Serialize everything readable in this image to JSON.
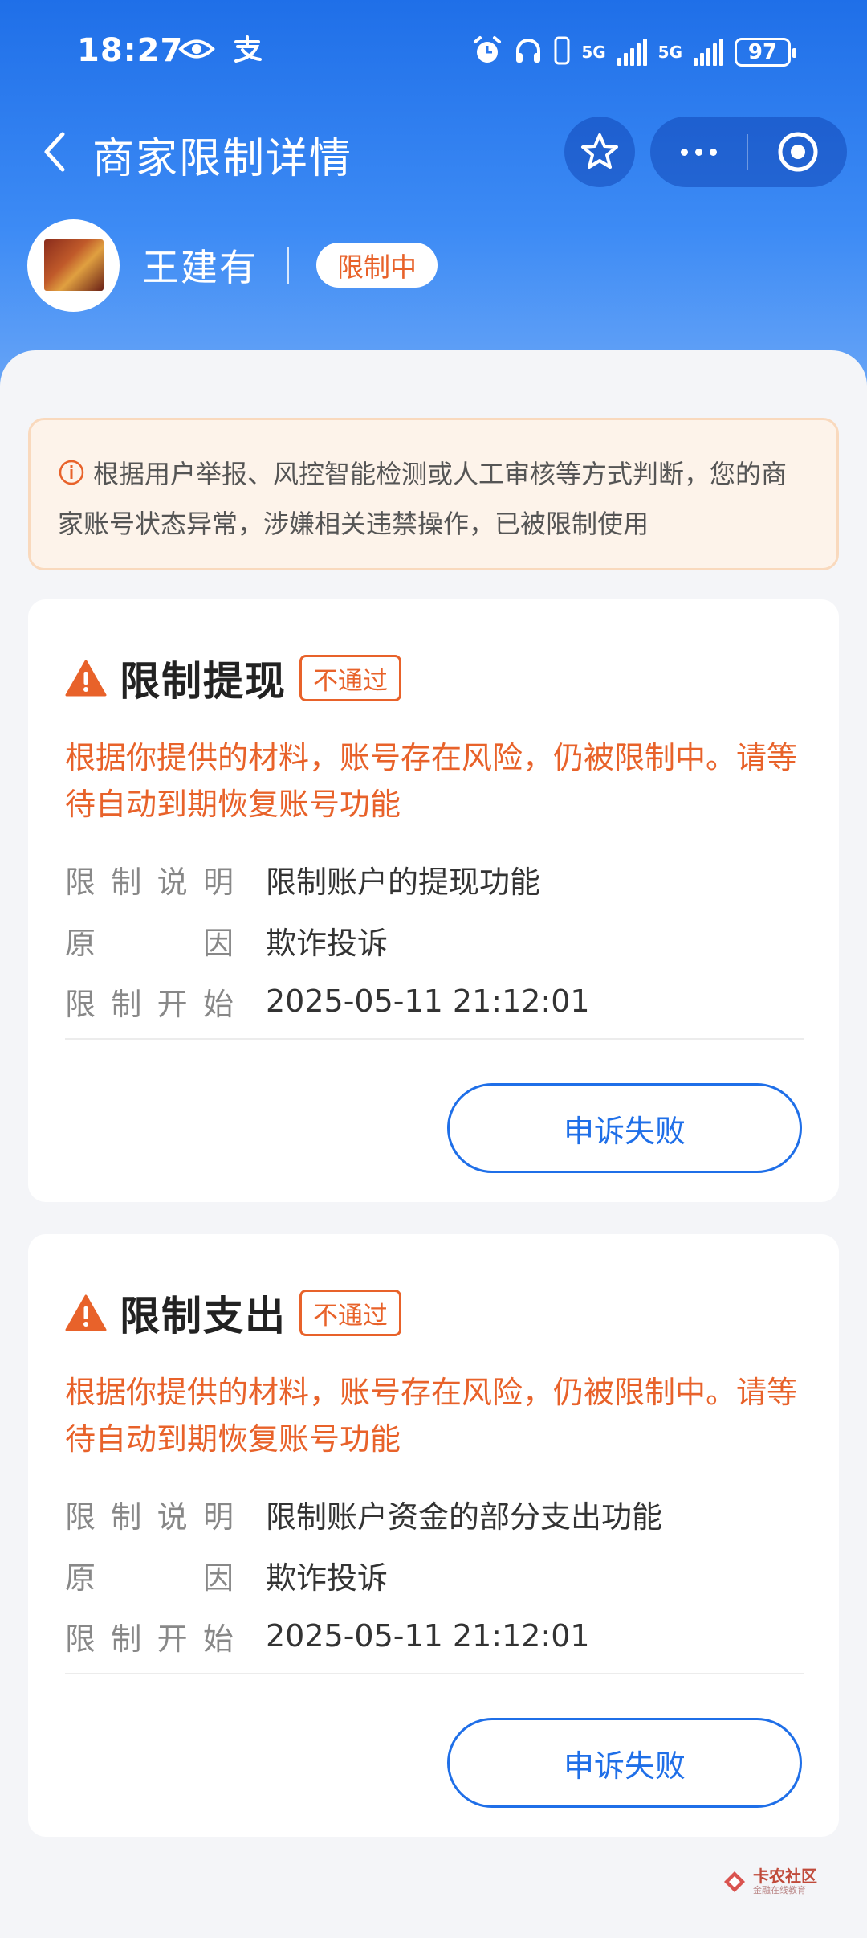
{
  "status_bar": {
    "time": "18:27",
    "net_label_1": "5G",
    "net_label_2": "5G",
    "battery": "97"
  },
  "nav": {
    "title": "商家限制详情"
  },
  "merchant": {
    "name": "王建有",
    "status": "限制中"
  },
  "notice": {
    "text": "根据用户举报、风控智能检测或人工审核等方式判断，您的商家账号状态异常，涉嫌相关违禁操作，已被限制使用"
  },
  "cards": [
    {
      "title": "限制提现",
      "tag": "不通过",
      "warning": "根据你提供的材料，账号存在风险，仍被限制中。请等待自动到期恢复账号功能",
      "rows": [
        {
          "label": "限制说明",
          "value": "限制账户的提现功能"
        },
        {
          "label": "原因",
          "value": "欺诈投诉"
        },
        {
          "label": "限制开始",
          "value": "2025-05-11 21:12:01"
        }
      ],
      "button": "申诉失败"
    },
    {
      "title": "限制支出",
      "tag": "不通过",
      "warning": "根据你提供的材料，账号存在风险，仍被限制中。请等待自动到期恢复账号功能",
      "rows": [
        {
          "label": "限制说明",
          "value": "限制账户资金的部分支出功能"
        },
        {
          "label": "原因",
          "value": "欺诈投诉"
        },
        {
          "label": "限制开始",
          "value": "2025-05-11 21:12:01"
        }
      ],
      "button": "申诉失败"
    }
  ],
  "watermark": {
    "title": "卡农社区",
    "subtitle": "金融在线教育"
  },
  "colors": {
    "brand_blue": "#1f6fe8",
    "warning_orange": "#e8622a",
    "notice_bg": "#fdf3ea"
  },
  "icons": [
    "back-icon",
    "star-icon",
    "more-icon",
    "target-close-icon",
    "info-icon",
    "warning-icon",
    "eye-icon",
    "alipay-icon",
    "alarm-icon",
    "headphones-icon",
    "battery-icon"
  ]
}
